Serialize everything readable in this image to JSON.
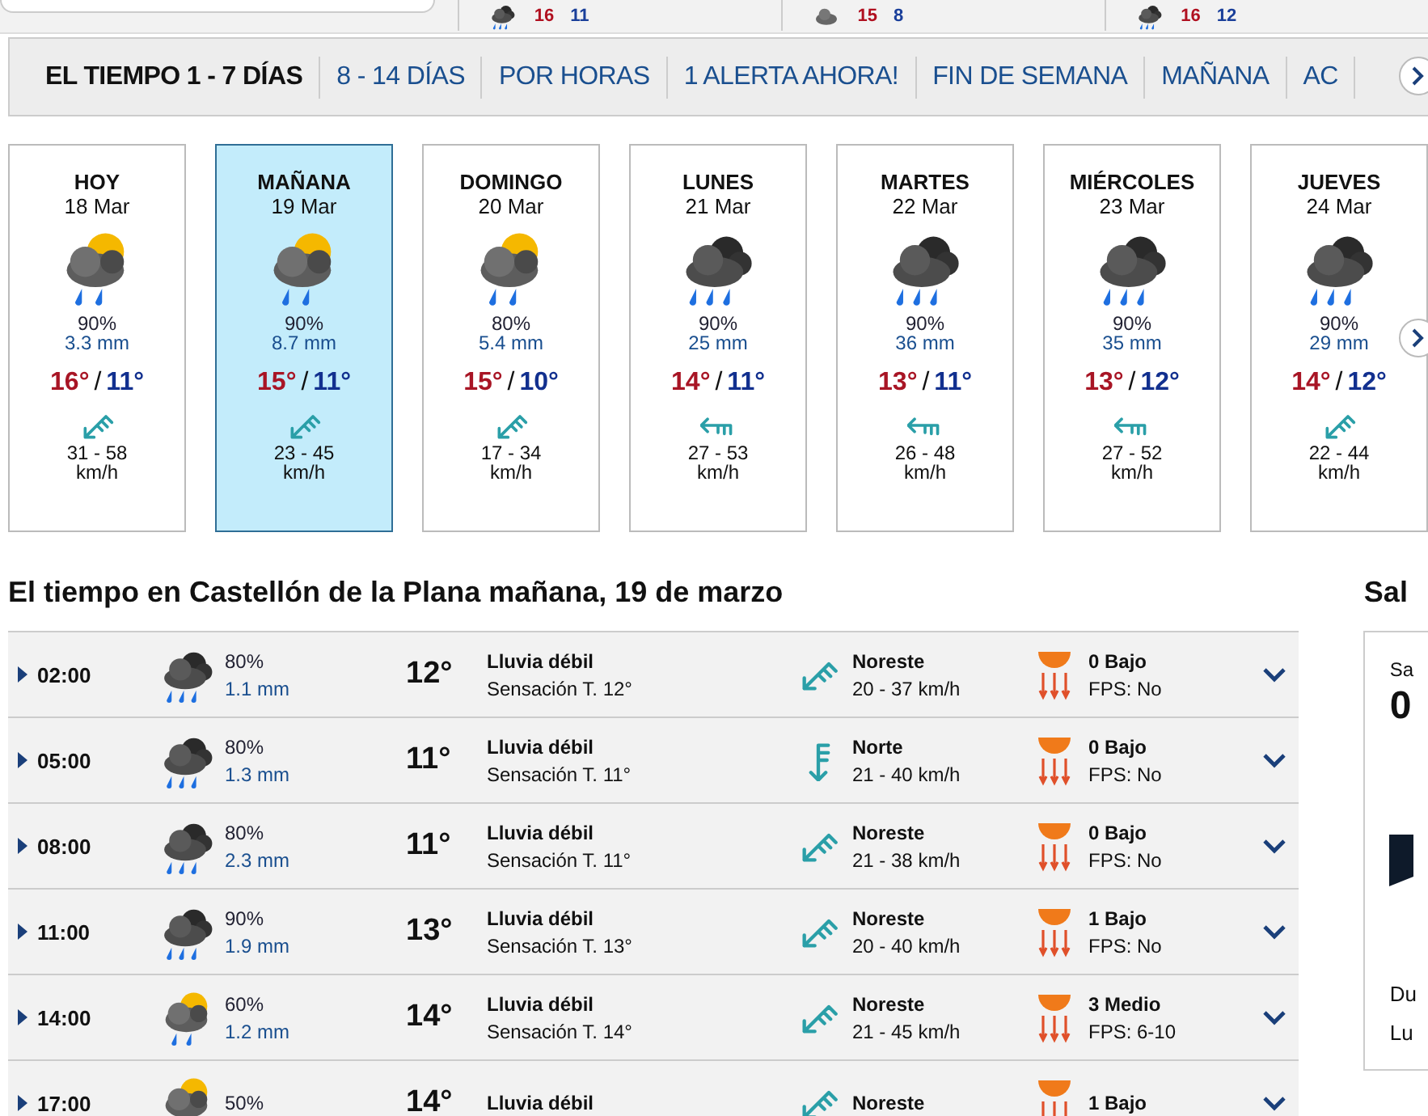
{
  "top_strip": [
    {
      "kind": "cloud-rain",
      "high": "16",
      "low": "11"
    },
    {
      "kind": "cloud",
      "high": "15",
      "low": "8"
    },
    {
      "kind": "cloud-rain",
      "high": "16",
      "low": "12"
    }
  ],
  "tabs": [
    {
      "label": "EL TIEMPO 1 - 7 DÍAS",
      "selected": true
    },
    {
      "label": "8 - 14 DÍAS",
      "selected": false
    },
    {
      "label": "POR HORAS",
      "selected": false
    },
    {
      "label": "1 ALERTA AHORA!",
      "selected": false
    },
    {
      "label": "FIN DE SEMANA",
      "selected": false
    },
    {
      "label": "MAÑANA",
      "selected": false
    },
    {
      "label": "AC",
      "selected": false
    }
  ],
  "days": [
    {
      "day": "HOY",
      "date": "18 Mar",
      "kind": "sun-cloud-rain",
      "prob": "90%",
      "rain": "3.3 mm",
      "high": "16°",
      "sep": "/",
      "low": "11°",
      "arrow": {
        "kind": "northeast"
      },
      "wind": "31 - 58",
      "unit": "km/h",
      "selected": false
    },
    {
      "day": "MAÑANA",
      "date": "19 Mar",
      "kind": "sun-cloud-rain",
      "prob": "90%",
      "rain": "8.7 mm",
      "high": "15°",
      "sep": "/",
      "low": "11°",
      "arrow": {
        "kind": "northeast"
      },
      "wind": "23 - 45",
      "unit": "km/h",
      "selected": true
    },
    {
      "day": "DOMINGO",
      "date": "20 Mar",
      "kind": "sun-cloud-rain",
      "prob": "80%",
      "rain": "5.4 mm",
      "high": "15°",
      "sep": "/",
      "low": "10°",
      "arrow": {
        "kind": "northeast"
      },
      "wind": "17 - 34",
      "unit": "km/h",
      "selected": false
    },
    {
      "day": "LUNES",
      "date": "21 Mar",
      "kind": "cloud-rain",
      "prob": "90%",
      "rain": "25 mm",
      "high": "14°",
      "sep": "/",
      "low": "11°",
      "arrow": {
        "kind": "east"
      },
      "wind": "27 - 53",
      "unit": "km/h",
      "selected": false
    },
    {
      "day": "MARTES",
      "date": "22 Mar",
      "kind": "cloud-rain",
      "prob": "90%",
      "rain": "36 mm",
      "high": "13°",
      "sep": "/",
      "low": "11°",
      "arrow": {
        "kind": "east"
      },
      "wind": "26 - 48",
      "unit": "km/h",
      "selected": false
    },
    {
      "day": "MIÉRCOLES",
      "date": "23 Mar",
      "kind": "cloud-rain",
      "prob": "90%",
      "rain": "35 mm",
      "high": "13°",
      "sep": "/",
      "low": "12°",
      "arrow": {
        "kind": "east"
      },
      "wind": "27 - 52",
      "unit": "km/h",
      "selected": false
    },
    {
      "day": "JUEVES",
      "date": "24 Mar",
      "kind": "cloud-rain",
      "prob": "90%",
      "rain": "29 mm",
      "high": "14°",
      "sep": "/",
      "low": "12°",
      "arrow": {
        "kind": "northeast"
      },
      "wind": "22 - 44",
      "unit": "km/h",
      "selected": false
    }
  ],
  "heading": "El tiempo en Castellón de la Plana mañana, 19 de marzo",
  "hours": [
    {
      "time": "02:00",
      "kind": "cloud-rain",
      "prob": "80%",
      "rain": "1.1 mm",
      "temp": "12°",
      "desc": "Lluvia débil",
      "feels": "Sensación T. 12°",
      "arrow": {
        "kind": "northeast"
      },
      "wind_name": "Noreste",
      "wind": "20 - 37 km/h",
      "uv": "0 Bajo",
      "fps": "FPS: No"
    },
    {
      "time": "05:00",
      "kind": "cloud-rain",
      "prob": "80%",
      "rain": "1.3 mm",
      "temp": "11°",
      "desc": "Lluvia débil",
      "feels": "Sensación T. 11°",
      "arrow": {
        "kind": "north"
      },
      "wind_name": "Norte",
      "wind": "21 - 40 km/h",
      "uv": "0 Bajo",
      "fps": "FPS: No"
    },
    {
      "time": "08:00",
      "kind": "cloud-rain",
      "prob": "80%",
      "rain": "2.3 mm",
      "temp": "11°",
      "desc": "Lluvia débil",
      "feels": "Sensación T. 11°",
      "arrow": {
        "kind": "northeast"
      },
      "wind_name": "Noreste",
      "wind": "21 - 38 km/h",
      "uv": "0 Bajo",
      "fps": "FPS: No"
    },
    {
      "time": "11:00",
      "kind": "cloud-rain",
      "prob": "90%",
      "rain": "1.9 mm",
      "temp": "13°",
      "desc": "Lluvia débil",
      "feels": "Sensación T. 13°",
      "arrow": {
        "kind": "northeast"
      },
      "wind_name": "Noreste",
      "wind": "20 - 40 km/h",
      "uv": "1 Bajo",
      "fps": "FPS: No"
    },
    {
      "time": "14:00",
      "kind": "sun-cloud-rain",
      "prob": "60%",
      "rain": "1.2 mm",
      "temp": "14°",
      "desc": "Lluvia débil",
      "feels": "Sensación T. 14°",
      "arrow": {
        "kind": "northeast"
      },
      "wind_name": "Noreste",
      "wind": "21 - 45 km/h",
      "uv": "3 Medio",
      "fps": "FPS: 6-10"
    },
    {
      "time": "17:00",
      "kind": "sun-cloud-rain",
      "prob": "50%",
      "temp": "14°",
      "desc": "Lluvia débil",
      "arrow": {
        "kind": "northeast"
      },
      "wind_name": "Noreste",
      "uv": "1 Bajo"
    }
  ],
  "side": {
    "heading": "Sal",
    "label": "Sa",
    "value": "0",
    "line_1": "Du",
    "line_2": "Lu"
  }
}
